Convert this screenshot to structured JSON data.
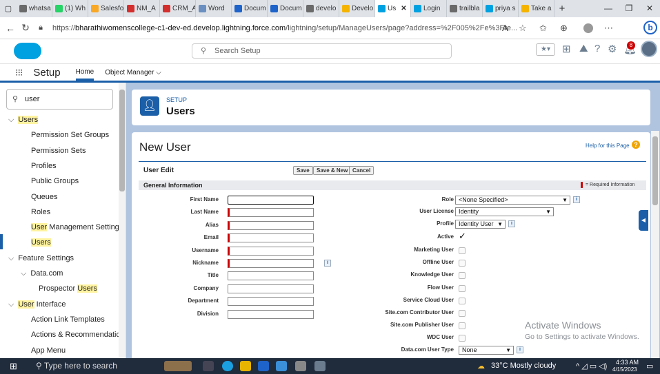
{
  "browser": {
    "tabs": [
      {
        "label": "whatsa",
        "color": "#6a6a6a"
      },
      {
        "label": "(1) Wh",
        "color": "#25d366"
      },
      {
        "label": "Salesfo",
        "color": "#f9a825"
      },
      {
        "label": "NM_A",
        "color": "#d32f2f"
      },
      {
        "label": "CRM_A",
        "color": "#d32f2f"
      },
      {
        "label": "Word",
        "color": "#6a8fc0"
      },
      {
        "label": "Docum",
        "color": "#1e63c9"
      },
      {
        "label": "Docum",
        "color": "#1e63c9"
      },
      {
        "label": "develo",
        "color": "#6a6a6a"
      },
      {
        "label": "Develo",
        "color": "#f5b400"
      },
      {
        "label": "Us",
        "color": "#00a1e0",
        "active": true
      },
      {
        "label": "Login",
        "color": "#00a1e0"
      },
      {
        "label": "trailbla",
        "color": "#6a6a6a"
      },
      {
        "label": "priya s",
        "color": "#00a1e0"
      },
      {
        "label": "Take a",
        "color": "#f5b400"
      }
    ],
    "new_tab": "+",
    "url_prefix": "https://",
    "url_host": "bharathiwomenscollege-c1-dev-ed.develop.lightning.force.com",
    "url_path": "/lightning/setup/ManageUsers/page?address=%2F005%2Fe%3Fre..."
  },
  "header": {
    "search_placeholder": "Search Setup",
    "notification_count": "8"
  },
  "appnav": {
    "app_name": "Setup",
    "home": "Home",
    "object_manager": "Object Manager"
  },
  "sidebar": {
    "quickfind_value": "user",
    "items": [
      {
        "pre": "",
        "hl": "Users",
        "post": "",
        "level": 0,
        "chev": true,
        "link": true
      },
      {
        "pre": "Permission Set Groups",
        "hl": "",
        "post": "",
        "level": 1
      },
      {
        "pre": "Permission Sets",
        "hl": "",
        "post": "",
        "level": 1
      },
      {
        "pre": "Profiles",
        "hl": "",
        "post": "",
        "level": 1
      },
      {
        "pre": "Public Groups",
        "hl": "",
        "post": "",
        "level": 1
      },
      {
        "pre": "Queues",
        "hl": "",
        "post": "",
        "level": 1
      },
      {
        "pre": "Roles",
        "hl": "",
        "post": "",
        "level": 1
      },
      {
        "pre": "",
        "hl": "User",
        "post": " Management Settings",
        "level": 1
      },
      {
        "pre": "",
        "hl": "Users",
        "post": "",
        "level": 1,
        "selected": true
      },
      {
        "pre": "Feature Settings",
        "hl": "",
        "post": "",
        "level": 0,
        "chev": true
      },
      {
        "pre": "Data.com",
        "hl": "",
        "post": "",
        "level": 1,
        "chev": true
      },
      {
        "pre": "Prospector ",
        "hl": "Users",
        "post": "",
        "level": 2
      },
      {
        "pre": "",
        "hl": "User",
        "post": " Interface",
        "level": 0,
        "chev": true
      },
      {
        "pre": "Action Link Templates",
        "hl": "",
        "post": "",
        "level": 1
      },
      {
        "pre": "Actions & Recommendations",
        "hl": "",
        "post": "",
        "level": 1
      },
      {
        "pre": "App Menu",
        "hl": "",
        "post": "",
        "level": 1
      }
    ]
  },
  "page": {
    "breadcrumb": "SETUP",
    "title": "Users",
    "form_title": "New User",
    "help_link": "Help for this Page",
    "section_title": "User Edit",
    "buttons": {
      "save": "Save",
      "save_new": "Save & New",
      "cancel": "Cancel"
    },
    "general_info": "General Information",
    "required_note": "= Required Information",
    "left_fields": [
      {
        "label": "First Name",
        "required": false
      },
      {
        "label": "Last Name",
        "required": true
      },
      {
        "label": "Alias",
        "required": true
      },
      {
        "label": "Email",
        "required": true
      },
      {
        "label": "Username",
        "required": true
      },
      {
        "label": "Nickname",
        "required": true
      },
      {
        "label": "Title",
        "required": false
      },
      {
        "label": "Company",
        "required": false
      },
      {
        "label": "Department",
        "required": false
      },
      {
        "label": "Division",
        "required": false
      }
    ],
    "role": {
      "label": "Role",
      "value": "<None Specified>"
    },
    "license": {
      "label": "User License",
      "value": "Identity"
    },
    "profile": {
      "label": "Profile",
      "value": "Identity User"
    },
    "active": {
      "label": "Active",
      "check": "✓"
    },
    "checkbox_fields": [
      "Marketing User",
      "Offline User",
      "Knowledge User",
      "Flow User",
      "Service Cloud User",
      "Site.com Contributor User",
      "Site.com Publisher User",
      "WDC User"
    ],
    "datacom_type": {
      "label": "Data.com User Type",
      "value": "None"
    }
  },
  "watermark": {
    "line1": "Activate Windows",
    "line2": "Go to Settings to activate Windows."
  },
  "taskbar": {
    "search_placeholder": "Type here to search",
    "weather": "33°C  Mostly cloudy",
    "time": "4:33 AM",
    "date": "4/15/2023"
  },
  "colors": {
    "brand": "#1b5fa8",
    "cloud": "#00a1e0",
    "required": "#c00000",
    "highlight": "#fff3a0"
  }
}
